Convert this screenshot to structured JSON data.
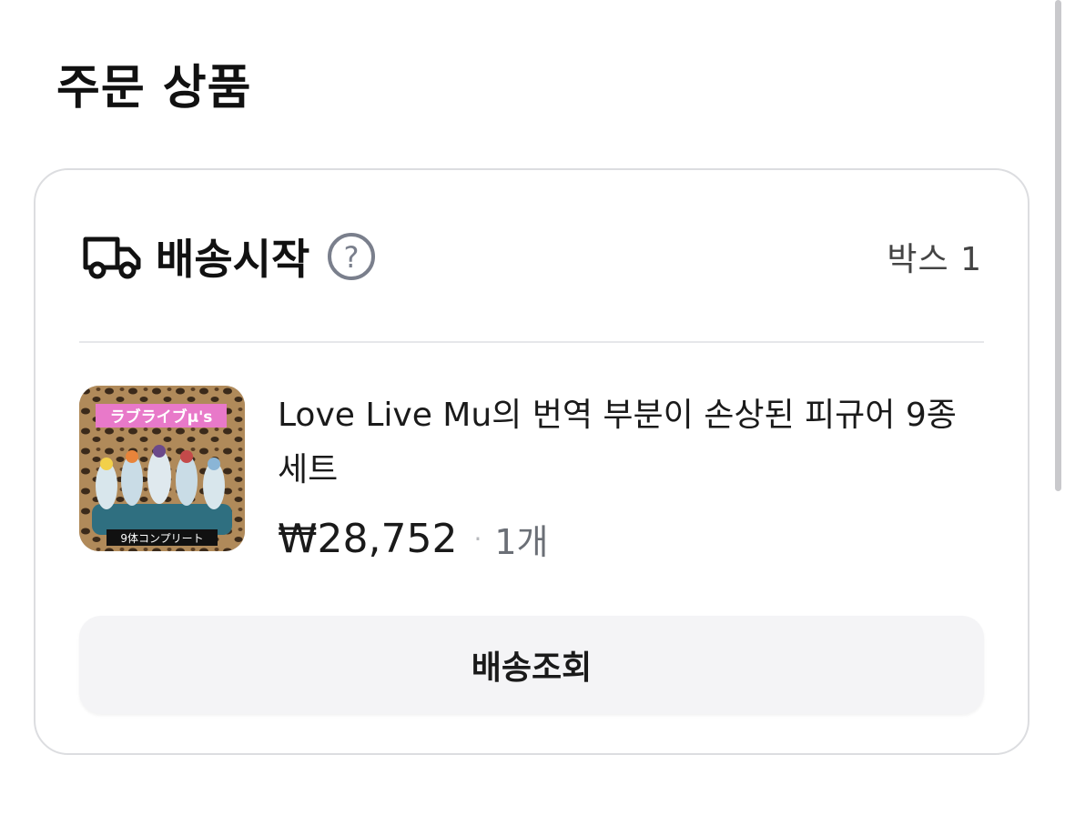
{
  "section": {
    "title": "주문 상품"
  },
  "shipment": {
    "truck_icon": "truck-icon",
    "status": "배송시작",
    "help_icon": "question-circle-icon",
    "box_label": "박스 1"
  },
  "product": {
    "thumb_banner": "ラブライブμ's",
    "thumb_caption": "9体コンプリート",
    "name": "Love Live Mu의 번역 부분이 손상된 피규어 9종 세트",
    "price": "₩28,752",
    "separator": "·",
    "quantity": "1개"
  },
  "actions": {
    "track_label": "배송조회"
  },
  "colors": {
    "accent_text": "#111111",
    "muted_text": "#6b6f76",
    "button_bg": "#f4f4f6",
    "card_border": "#dcdde0",
    "thumb_banner_bg": "#e879c9"
  }
}
